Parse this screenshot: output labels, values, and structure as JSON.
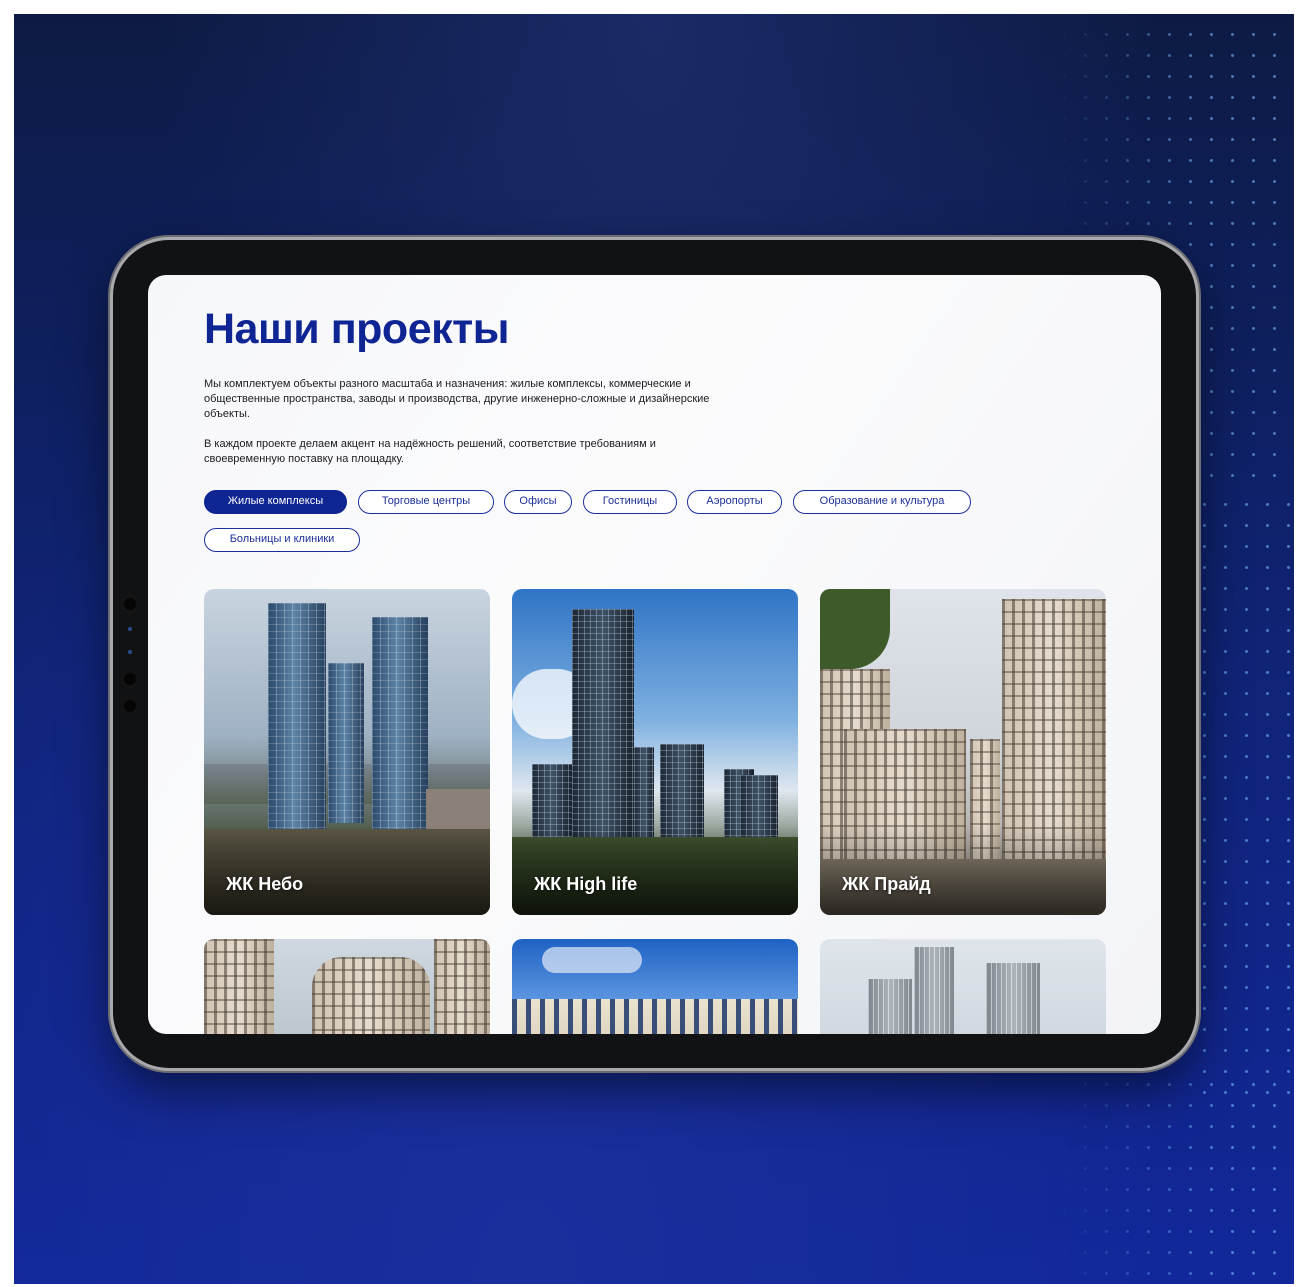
{
  "page": {
    "title": "Наши проекты",
    "description_1": "Мы комплектуем объекты разного масштаба и назначения: жилые комплексы, коммерческие и общественные пространства, заводы и производства, другие инженерно-сложные и дизайнерские объекты.",
    "description_2": "В каждом проекте делаем акцент на надёжность решений, соответствие требованиям и своевременную поставку на площадку."
  },
  "filters": [
    {
      "label": "Жилые комплексы",
      "active": true
    },
    {
      "label": "Торговые центры",
      "active": false
    },
    {
      "label": "Офисы",
      "active": false
    },
    {
      "label": "Гостиницы",
      "active": false
    },
    {
      "label": "Аэропорты",
      "active": false
    },
    {
      "label": "Образование и культура",
      "active": false
    },
    {
      "label": "Больницы и клиники",
      "active": false
    }
  ],
  "projects": [
    {
      "label": "ЖК Небо"
    },
    {
      "label": "ЖК High life"
    },
    {
      "label": "ЖК Прайд"
    },
    {
      "label": ""
    },
    {
      "label": ""
    },
    {
      "label": ""
    }
  ],
  "colors": {
    "brand": "#0f2593",
    "background_dark": "#0d1b44",
    "background_accent": "#12279a",
    "chip_border": "#1c2f9a"
  }
}
